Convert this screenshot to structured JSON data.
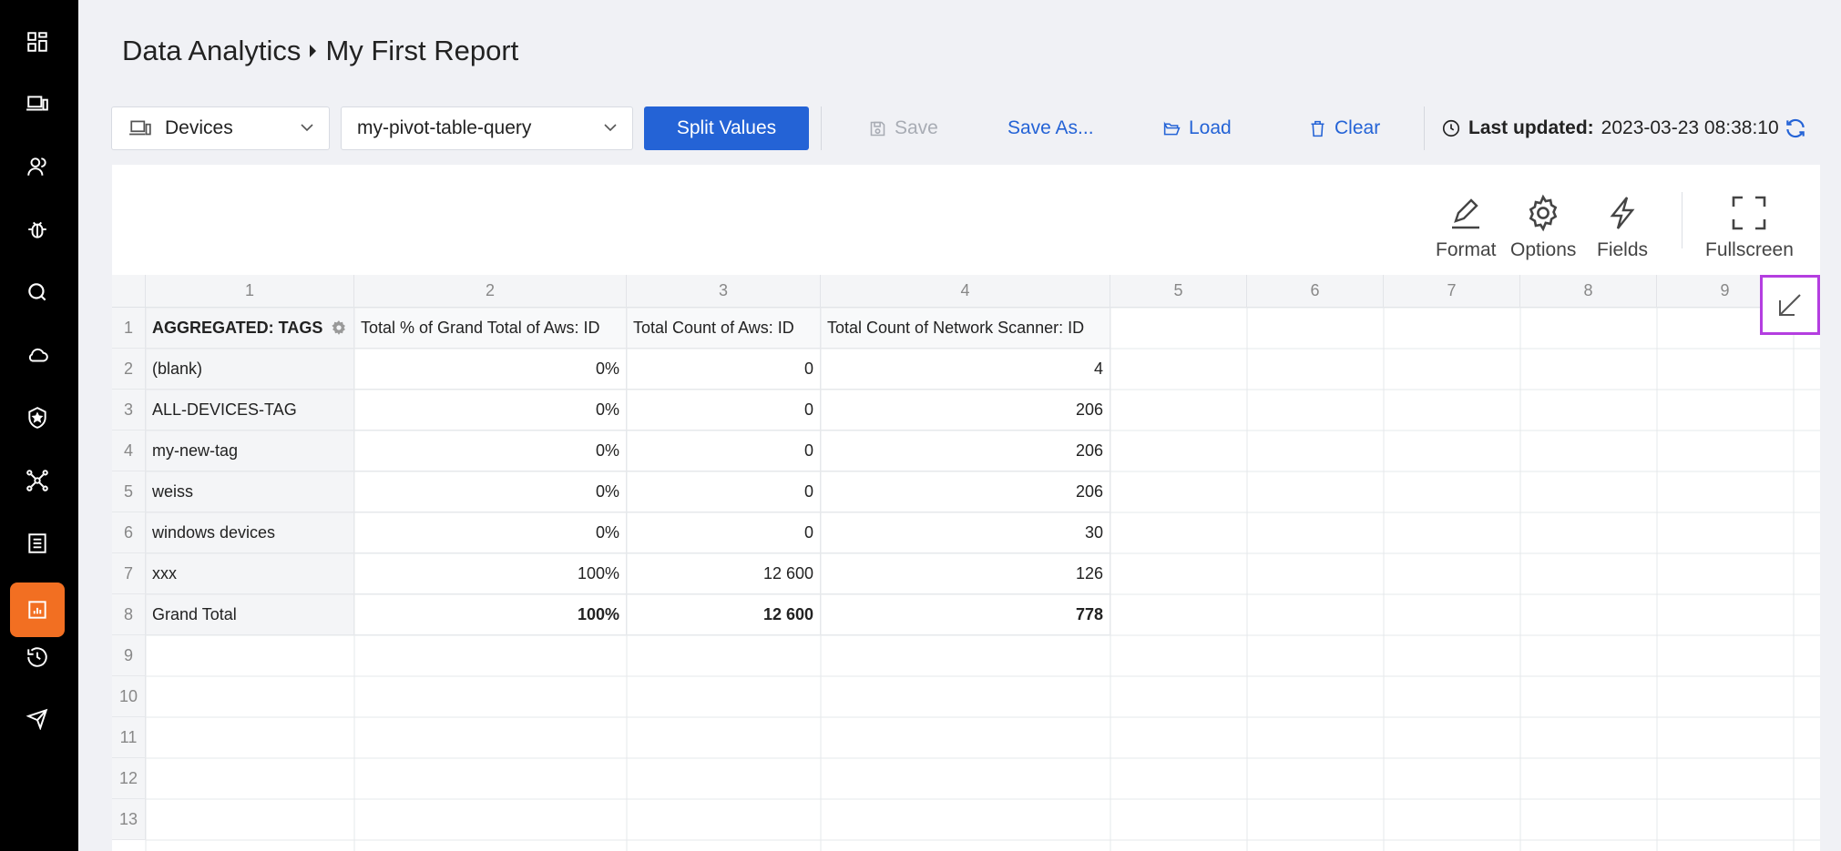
{
  "sidebar": {
    "items": [
      {
        "icon": "dashboard-icon"
      },
      {
        "icon": "devices-icon"
      },
      {
        "icon": "users-icon"
      },
      {
        "icon": "bug-icon"
      },
      {
        "icon": "query-icon"
      },
      {
        "icon": "cloud-icon"
      },
      {
        "icon": "security-shield-icon"
      },
      {
        "icon": "network-icon"
      },
      {
        "icon": "reports-list-icon"
      },
      {
        "icon": "data-analytics-icon",
        "active": true
      },
      {
        "icon": "history-icon"
      },
      {
        "icon": "send-icon"
      }
    ],
    "active_color": "#f26f22"
  },
  "breadcrumb": {
    "parent": "Data Analytics",
    "current": "My First Report"
  },
  "toolbar": {
    "entity_select": "Devices",
    "query_select": "my-pivot-table-query",
    "split_values": "Split Values",
    "save": "Save",
    "save_as": "Save As...",
    "load": "Load",
    "clear": "Clear",
    "last_updated_label": "Last updated:",
    "last_updated_value": "2023-03-23 08:38:10",
    "primary_color": "#2463d6"
  },
  "pivot_tools": {
    "format": "Format",
    "options": "Options",
    "fields": "Fields",
    "fullscreen": "Fullscreen"
  },
  "grid": {
    "col_headers": [
      "1",
      "2",
      "3",
      "4",
      "5",
      "6",
      "7",
      "8",
      "9"
    ],
    "row_numbers": [
      "1",
      "2",
      "3",
      "4",
      "5",
      "6",
      "7",
      "8",
      "9",
      "10",
      "11",
      "12",
      "13"
    ],
    "header_row": [
      "AGGREGATED: TAGS",
      "Total % of Grand Total of Aws: ID",
      "Total Count of Aws: ID",
      "Total Count of Network Scanner: ID"
    ],
    "rows": [
      [
        "(blank)",
        "0%",
        "0",
        "4"
      ],
      [
        "ALL-DEVICES-TAG",
        "0%",
        "0",
        "206"
      ],
      [
        "my-new-tag",
        "0%",
        "0",
        "206"
      ],
      [
        "weiss",
        "0%",
        "0",
        "206"
      ],
      [
        "windows devices",
        "0%",
        "0",
        "30"
      ],
      [
        "xxx",
        "100%",
        "12 600",
        "126"
      ],
      [
        "Grand Total",
        "100%",
        "12 600",
        "778"
      ]
    ]
  },
  "highlight_color": "#b43ee0"
}
